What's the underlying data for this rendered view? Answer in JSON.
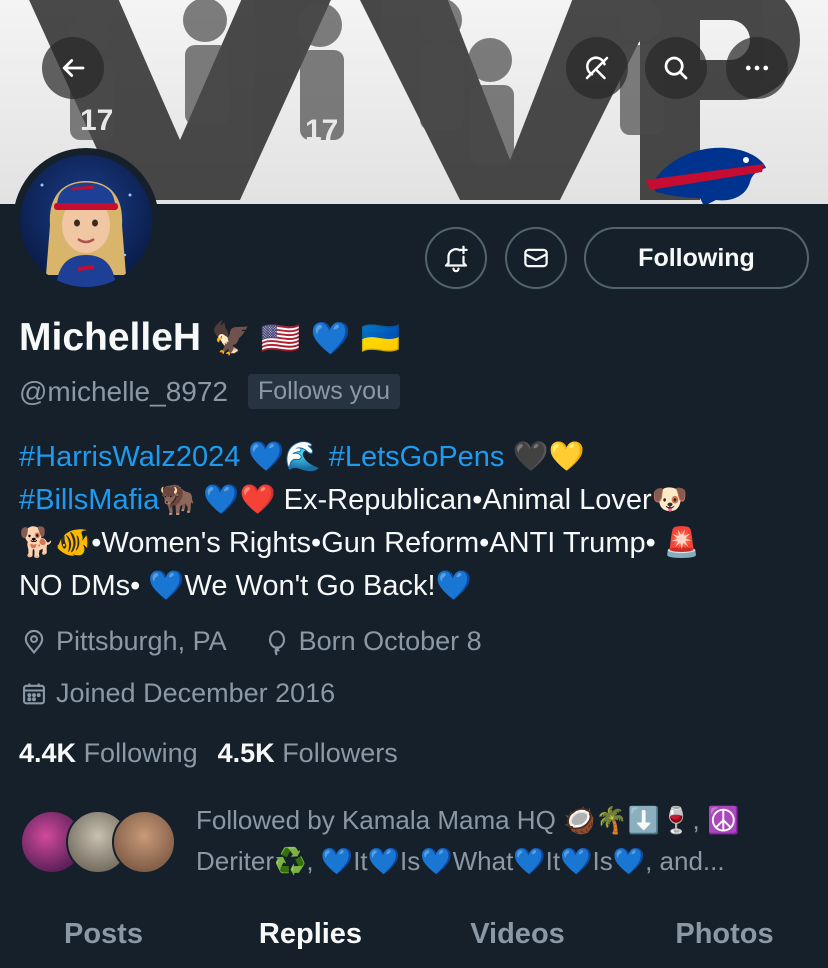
{
  "header": {
    "back_icon": "arrow-left-icon",
    "grok_icon": "grok-icon",
    "search_icon": "search-icon",
    "more_icon": "more-icon"
  },
  "profile": {
    "display_name": "MichelleH",
    "name_emojis": [
      "🦅",
      "🇺🇸",
      "💙",
      "🇺🇦"
    ],
    "handle": "@michelle_8972",
    "follows_you": "Follows you",
    "follow_button": "Following",
    "bio": {
      "line1": [
        "#HarrisWalz2024",
        " 💙🌊 ",
        "#LetsGoPens",
        " 🖤💛"
      ],
      "line2": [
        "#BillsMafia",
        "🦬 💙❤️ Ex-Republican•Animal Lover🐶"
      ],
      "line3": "🐕🐠•Women's Rights•Gun Reform•ANTI Trump• 🚨",
      "line4": "NO DMs• 💙We Won't Go Back!💙"
    },
    "location": "Pittsburgh, PA",
    "birthday": "Born October 8",
    "joined": "Joined December 2016",
    "following_count": "4.4K",
    "following_label": "Following",
    "followers_count": "4.5K",
    "followers_label": "Followers",
    "followed_by_line1": "Followed by Kamala Mama HQ 🥥🌴⬇️🍷, ☮️",
    "followed_by_line2": "Deriter♻️, 💙It💙Is💙What💙It💙Is💙, and..."
  },
  "tabs": [
    "Posts",
    "Replies",
    "Videos",
    "Photos"
  ],
  "active_tab": "Replies",
  "colors": {
    "background": "#15202b",
    "accent": "#1d9bf0",
    "muted": "#8b98a5",
    "bills_blue": "#00338d",
    "bills_red": "#c60c30"
  }
}
